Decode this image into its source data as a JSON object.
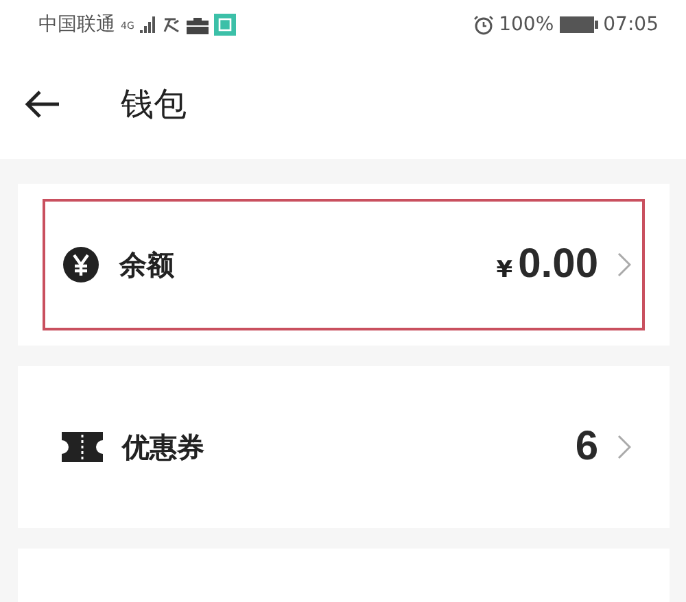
{
  "status_bar": {
    "carrier": "中国联通",
    "network": "4G",
    "battery": "100%",
    "time": "07:05"
  },
  "header": {
    "title": "钱包"
  },
  "items": [
    {
      "kind": "balance",
      "label": "余额",
      "currency": "¥",
      "value": "0.00",
      "highlighted": true
    },
    {
      "kind": "coupon",
      "label": "优惠券",
      "value": "6",
      "highlighted": false
    }
  ]
}
